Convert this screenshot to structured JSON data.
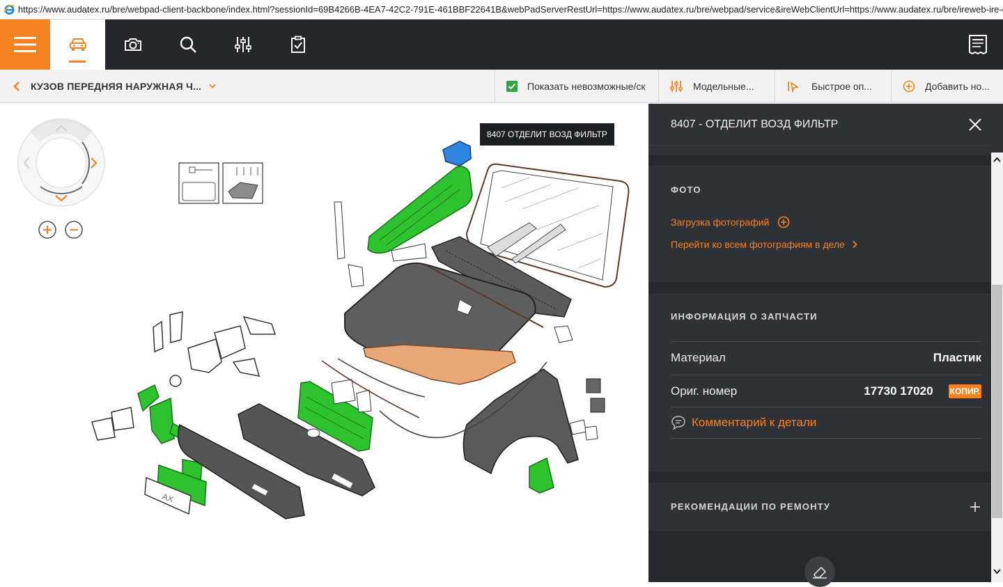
{
  "browser": {
    "url": "https://www.audatex.ru/bre/webpad-client-backbone/index.html?sessionId=69B4266B-4EA7-42C2-791E-461BBF22641B&webPadServerRestUrl=https://www.audatex.ru/bre/webpad/service&ireWebClientUrl=https://www.audatex.ru/bre/ireweb-ire-client/index.html"
  },
  "toolbar": {
    "icons": [
      "menu-icon",
      "car-icon",
      "camera-icon",
      "search-icon",
      "sliders-icon",
      "clipboard-check-icon",
      "report-icon"
    ],
    "accent_color": "#f58220",
    "bg_color": "#24262b"
  },
  "subbar": {
    "breadcrumb": "КУЗОВ ПЕРЕДНЯЯ НАРУЖНАЯ Ч...",
    "show_impossible": "Показать невозможные/ск",
    "model": "Модельные...",
    "quick": "Быстрое оп...",
    "add_new": "Добавить но..."
  },
  "canvas": {
    "tooltip": "8407 ОТДЕЛИТ ВОЗД ФИЛЬТР",
    "plate_text": "AX",
    "highlight_green": "#2fc22f",
    "highlight_blue": "#2f86e0",
    "highlight_orange": "#e8a878"
  },
  "panel": {
    "title": "8407 - ОТДЕЛИТ ВОЗД ФИЛЬТР",
    "photo_section": "ФОТО",
    "upload_photos": "Загрузка фотографий",
    "all_photos": "Перейти ко всем фотографиям в деле",
    "info_section": "ИНФОРМАЦИЯ О ЗАПЧАСТИ",
    "material_label": "Материал",
    "material_value": "Пластик",
    "orig_label": "Ориг. номер",
    "orig_value": "17730 17020",
    "copy_label": "КОПИР.",
    "comment": "Комментарий к детали",
    "repair_section": "РЕКОМЕНДАЦИИ ПО РЕМОНТУ"
  }
}
